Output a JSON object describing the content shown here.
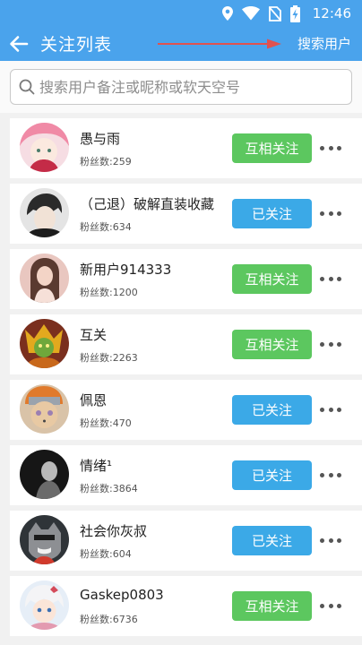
{
  "status_bar": {
    "time": "12:46"
  },
  "app_bar": {
    "title": "关注列表",
    "action": "搜索用户"
  },
  "search": {
    "placeholder": "搜索用户备注或昵称或软天空号"
  },
  "users": [
    {
      "name": "愚与雨",
      "fans": "粉丝数:259",
      "button": "互相关注",
      "state": "mutual"
    },
    {
      "name": "（己退）破解直装收藏",
      "fans": "粉丝数:634",
      "button": "已关注",
      "state": "followed"
    },
    {
      "name": "新用户914333",
      "fans": "粉丝数:1200",
      "button": "互相关注",
      "state": "mutual"
    },
    {
      "name": "互关",
      "fans": "粉丝数:2263",
      "button": "互相关注",
      "state": "mutual"
    },
    {
      "name": "佩恩",
      "fans": "粉丝数:470",
      "button": "已关注",
      "state": "followed"
    },
    {
      "name": "情绪¹",
      "fans": "粉丝数:3864",
      "button": "已关注",
      "state": "followed"
    },
    {
      "name": "社会你灰叔",
      "fans": "粉丝数:604",
      "button": "已关注",
      "state": "followed"
    },
    {
      "name": "Gaskep0803",
      "fans": "粉丝数:6736",
      "button": "互相关注",
      "state": "mutual"
    }
  ],
  "colors": {
    "header": "#4aa3ec",
    "mutual_button": "#5cc75f",
    "followed_button": "#3ba9e7",
    "annotation_arrow": "#e0524f"
  },
  "icons": [
    "location-icon",
    "wifi-icon",
    "no-sim-icon",
    "battery-charging-icon",
    "back-arrow-icon",
    "search-icon",
    "more-icon"
  ]
}
